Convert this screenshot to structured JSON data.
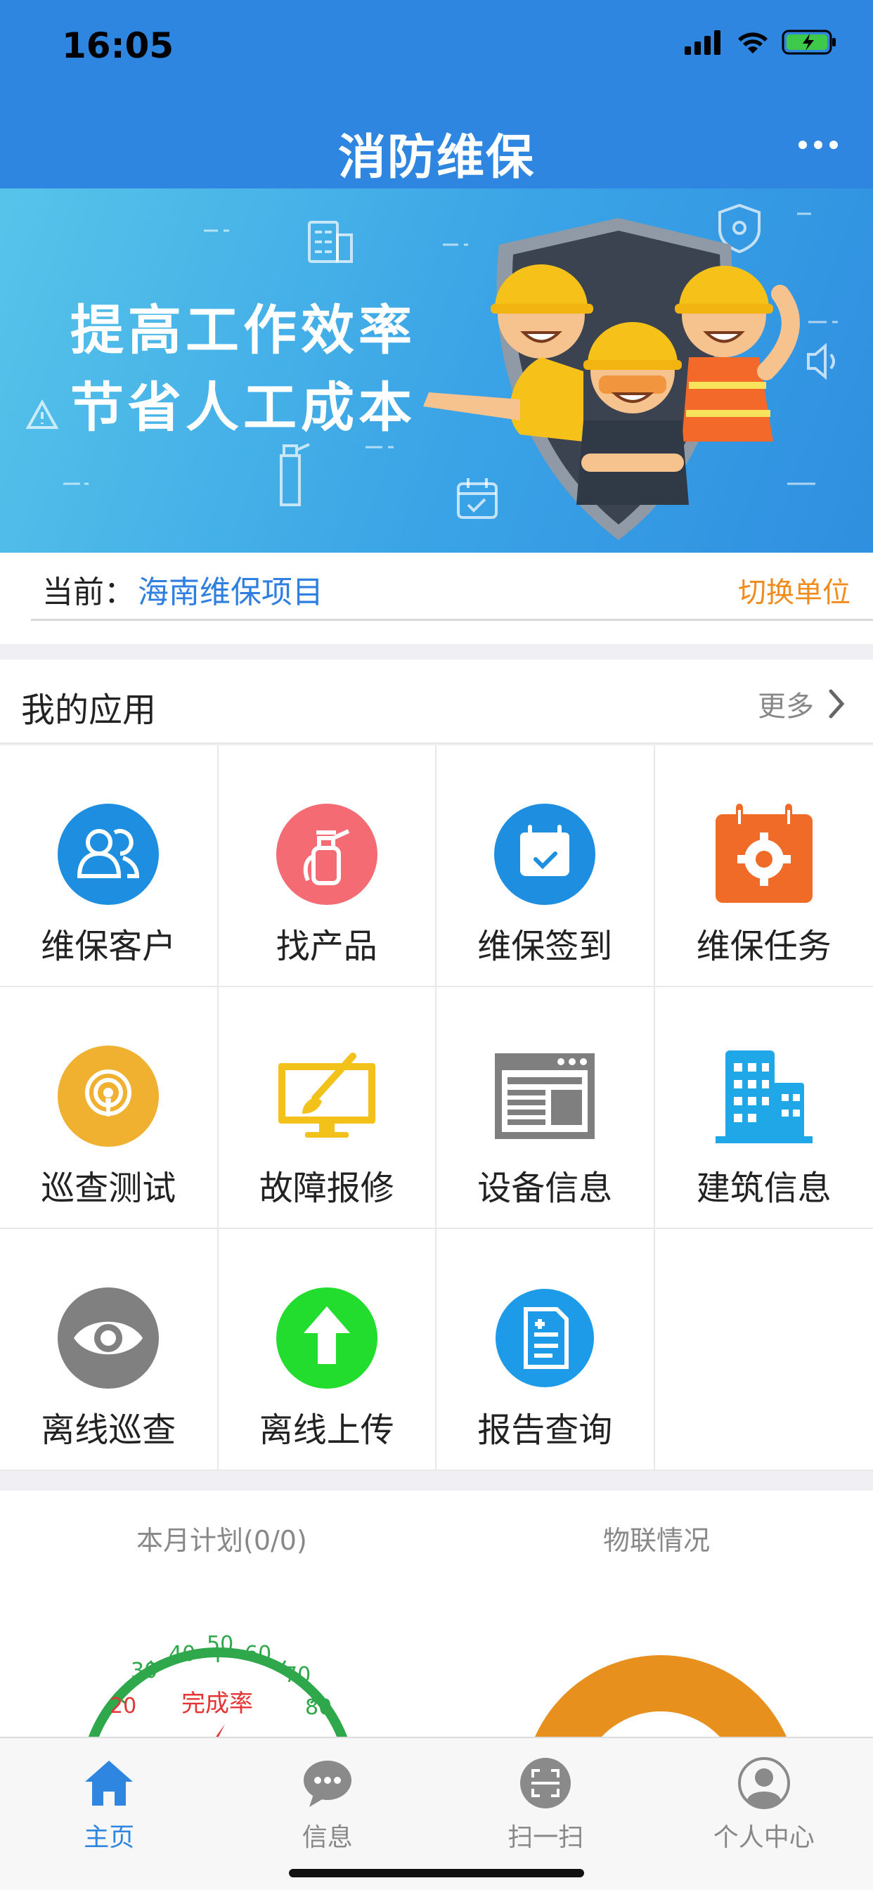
{
  "status": {
    "time": "16:05",
    "icons": [
      "signal-icon",
      "wifi-icon",
      "battery-icon"
    ]
  },
  "nav": {
    "title": "消防维保",
    "more_icon": "more-icon"
  },
  "banner": {
    "line1": "提高工作效率",
    "line2": "节省人工成本"
  },
  "current": {
    "label": "当前：",
    "value": "海南维保项目",
    "switch_label": "切换单位"
  },
  "apps": {
    "title": "我的应用",
    "more_label": "更多",
    "items": [
      {
        "label": "维保客户",
        "icon": "customers-icon",
        "color": "#1e8fe0"
      },
      {
        "label": "找产品",
        "icon": "fire-extinguisher-icon",
        "color": "#f46b74"
      },
      {
        "label": "维保签到",
        "icon": "calendar-check-icon",
        "color": "#1e8fe0"
      },
      {
        "label": "维保任务",
        "icon": "task-gear-icon",
        "color": "#f06a28"
      },
      {
        "label": "巡查测试",
        "icon": "patrol-test-icon",
        "color": "#f0b030"
      },
      {
        "label": "故障报修",
        "icon": "repair-brush-icon",
        "color": "#f2c21a"
      },
      {
        "label": "设备信息",
        "icon": "device-info-icon",
        "color": "#7f7f7f"
      },
      {
        "label": "建筑信息",
        "icon": "building-icon",
        "color": "#1fa7e8"
      },
      {
        "label": "离线巡查",
        "icon": "eye-icon",
        "color": "#808080"
      },
      {
        "label": "离线上传",
        "icon": "upload-icon",
        "color": "#22dd2e"
      },
      {
        "label": "报告查询",
        "icon": "report-icon",
        "color": "#1e9be8"
      }
    ]
  },
  "stats": {
    "plan_title": "本月计划(0/0)",
    "gauge_label": "完成率",
    "gauge_ticks": [
      "20",
      "30",
      "40",
      "50",
      "60",
      "70",
      "80"
    ],
    "iot_title": "物联情况"
  },
  "tabbar": [
    {
      "label": "主页",
      "icon": "home-icon",
      "active": true
    },
    {
      "label": "信息",
      "icon": "message-icon",
      "active": false
    },
    {
      "label": "扫一扫",
      "icon": "scan-icon",
      "active": false
    },
    {
      "label": "个人中心",
      "icon": "profile-icon",
      "active": false
    }
  ]
}
